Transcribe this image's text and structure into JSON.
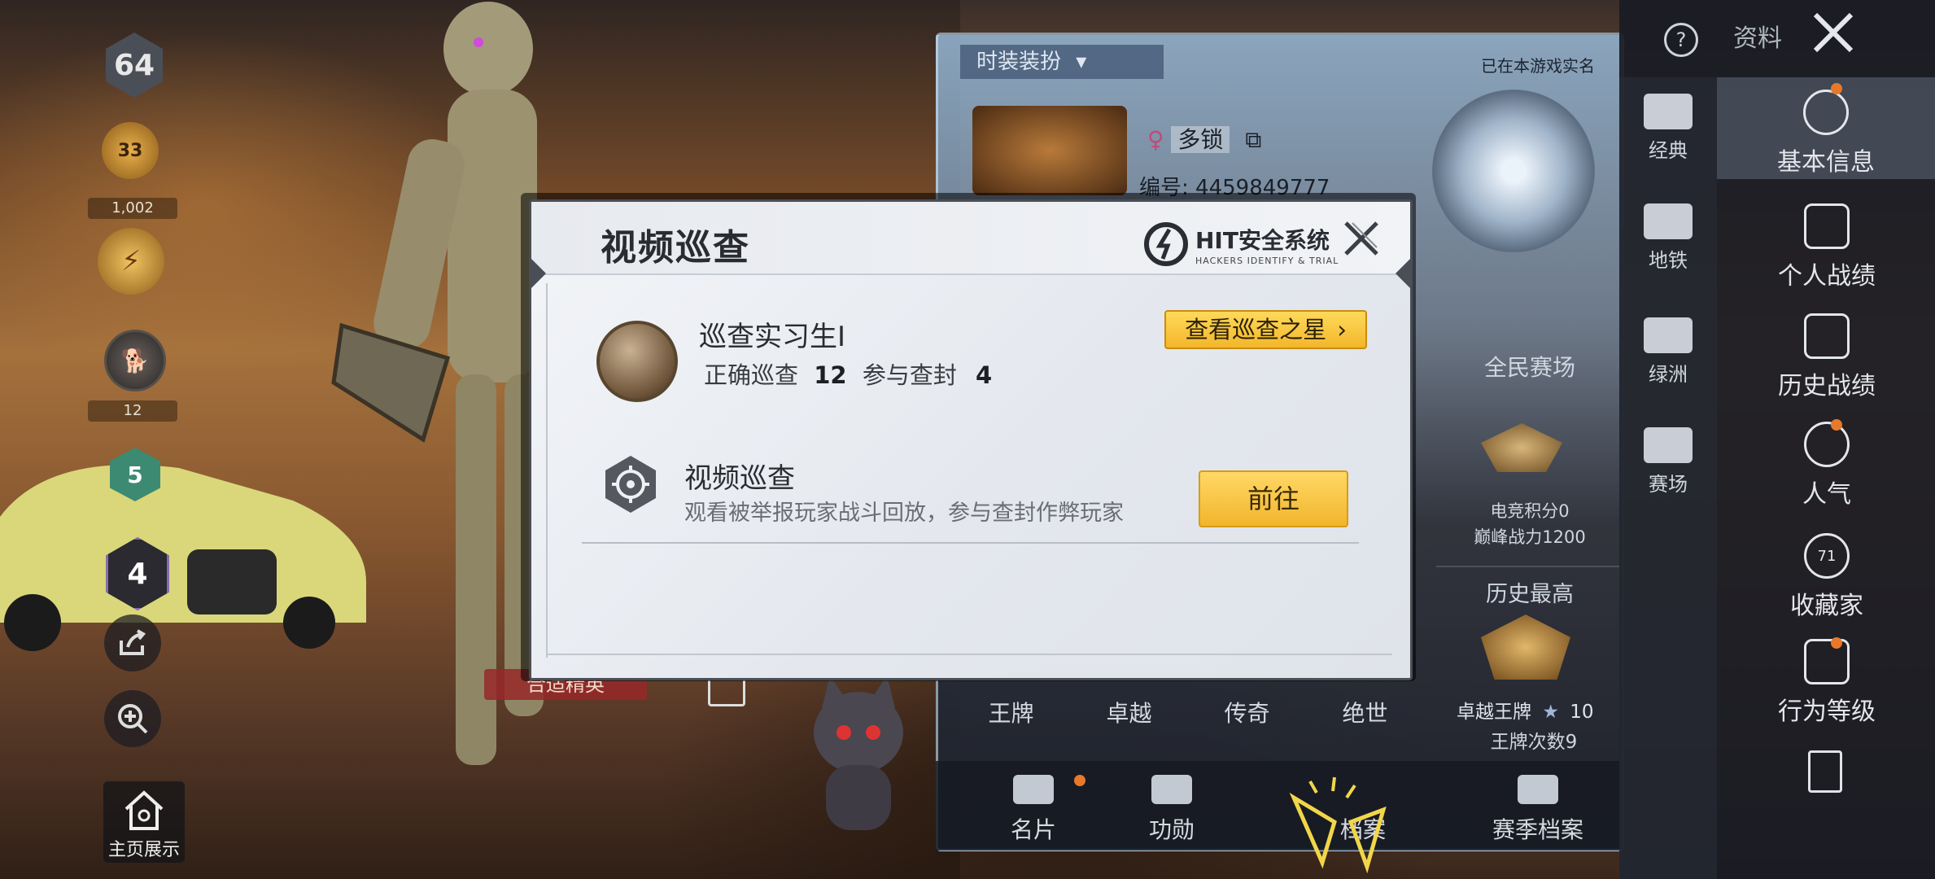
{
  "left_rail": {
    "level": "64",
    "tier_badge_value": "33",
    "tier_badge_caption": "1,002",
    "badge2_caption": "12",
    "shield_value": "5",
    "rank_value": "4",
    "note_text": "合适精英",
    "home_label": "主页展示"
  },
  "profile": {
    "nickname_label": "多锁",
    "id_label": "编号: 4459849777",
    "outfit_label": "时装装扮",
    "realname_status": "已在本游戏实名",
    "stats_header": "全民赛场",
    "esports_points": "电竞积分0",
    "peak_power": "巅峰战力1200",
    "history_header": "历史最高",
    "history_rank": "卓越王牌",
    "history_stars": "10",
    "ace_count": "王牌次数9",
    "tier_labels": [
      "王牌",
      "卓越",
      "传奇",
      "绝世"
    ],
    "bottom_tabs": [
      {
        "label": "名片",
        "icon": "card-icon"
      },
      {
        "label": "功勋",
        "icon": "medal-icon"
      },
      {
        "label": "档案",
        "icon": "archive-icon"
      },
      {
        "label": "赛季档案",
        "icon": "season-icon"
      }
    ]
  },
  "right_nav": {
    "help_label": "?",
    "header_label": "资料",
    "col1": [
      {
        "label": "经典",
        "icon": "classic-icon"
      },
      {
        "label": "地铁",
        "icon": "metro-icon"
      },
      {
        "label": "绿洲",
        "icon": "oasis-icon"
      },
      {
        "label": "赛场",
        "icon": "arena-icon"
      }
    ],
    "col2": [
      {
        "label": "基本信息",
        "icon": "basic-info-icon",
        "active": true
      },
      {
        "label": "个人战绩",
        "icon": "personal-stats-icon"
      },
      {
        "label": "历史战绩",
        "icon": "history-stats-icon"
      },
      {
        "label": "人气",
        "icon": "popularity-icon"
      },
      {
        "label": "收藏家",
        "icon": "collector-icon",
        "badge": "71"
      },
      {
        "label": "行为等级",
        "icon": "behavior-icon"
      }
    ]
  },
  "modal": {
    "title": "视频巡查",
    "brand": "HIT安全系统",
    "brand_sub": "HACKERS IDENTIFY & TRIAL",
    "rank_title": "巡查实习生I",
    "stats_label_correct": "正确巡查",
    "stats_correct": "12",
    "stats_label_join": "参与查封",
    "stats_join": "4",
    "view_stars_button": "查看巡查之星",
    "patrol_title": "视频巡查",
    "patrol_desc": "观看被举报玩家战斗回放，参与查封作弊玩家",
    "go_button": "前往"
  },
  "colors": {
    "accent_yellow": "#f3b62b",
    "notify_dot": "#e8792a",
    "modal_bg": "#eef1f5"
  }
}
